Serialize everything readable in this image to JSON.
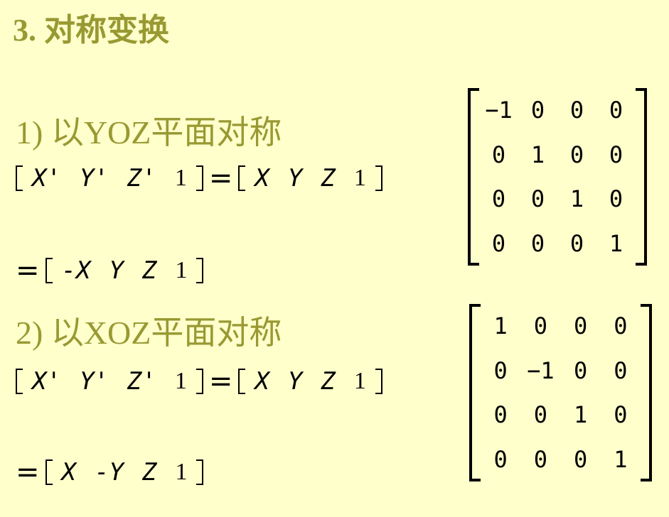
{
  "title": "3. 对称变换",
  "sections": [
    {
      "heading": "1) 以YOZ平面对称",
      "lhs": [
        "X'",
        "Y'",
        "Z'",
        "1"
      ],
      "eq": "=",
      "rhs": [
        "X",
        "Y",
        "Z",
        "1"
      ],
      "matrix": [
        [
          "−1",
          "0",
          "0",
          "0"
        ],
        [
          "0",
          "1",
          "0",
          "0"
        ],
        [
          "0",
          "0",
          "1",
          "0"
        ],
        [
          "0",
          "0",
          "0",
          "1"
        ]
      ],
      "result_eq": "=",
      "result": [
        "-X",
        "Y",
        "Z",
        "1"
      ]
    },
    {
      "heading": "2) 以XOZ平面对称",
      "lhs": [
        "X'",
        "Y'",
        "Z'",
        "1"
      ],
      "eq": "=",
      "rhs": [
        "X",
        "Y",
        "Z",
        "1"
      ],
      "matrix": [
        [
          "1",
          "0",
          "0",
          "0"
        ],
        [
          "0",
          "−1",
          "0",
          "0"
        ],
        [
          "0",
          "0",
          "1",
          "0"
        ],
        [
          "0",
          "0",
          "0",
          "1"
        ]
      ],
      "result_eq": "=",
      "result": [
        "X",
        "-Y",
        "Z",
        "1"
      ]
    }
  ]
}
